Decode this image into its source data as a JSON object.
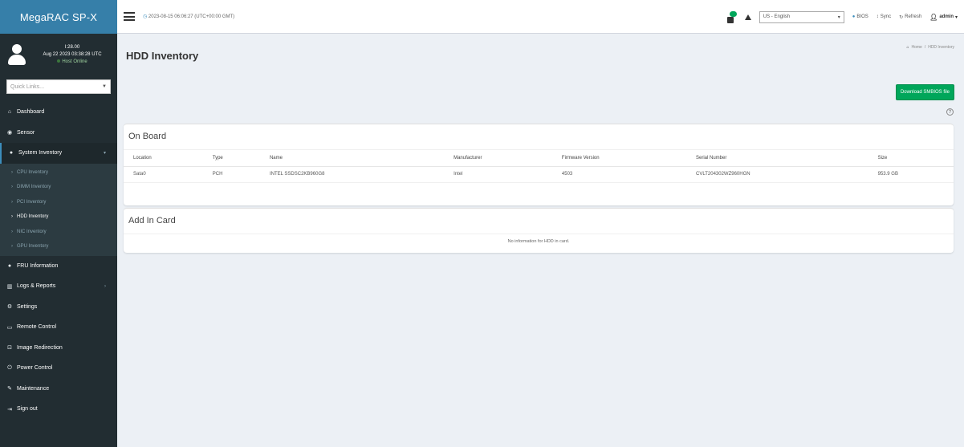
{
  "brand": "MegaRAC SP-X",
  "user_panel": {
    "line1": "I:28.00",
    "line2": "Aug 22 2023 03:38:28 UTC",
    "status": "Host Online"
  },
  "quick_links": {
    "placeholder": "Quick Links..."
  },
  "sidebar": {
    "items_top": [
      {
        "label": "Dashboard",
        "icon": "dashboard-icon",
        "glyph": "⌂"
      },
      {
        "label": "Sensor",
        "icon": "sensor-icon",
        "glyph": "◉"
      }
    ],
    "system_inventory": {
      "label": "System Inventory",
      "icon": "inventory-icon",
      "glyph": "●",
      "arrow": "▾"
    },
    "subitems": [
      {
        "label": "CPU Inventory",
        "active": false
      },
      {
        "label": "DIMM Inventory",
        "active": false
      },
      {
        "label": "PCI Inventory",
        "active": false
      },
      {
        "label": "HDD Inventory",
        "active": true
      },
      {
        "label": "NIC Inventory",
        "active": false
      },
      {
        "label": "GPU Inventory",
        "active": false
      }
    ],
    "items_bottom": [
      {
        "label": "FRU Information",
        "icon": "fru-icon",
        "glyph": "●",
        "arrow": ""
      },
      {
        "label": "Logs & Reports",
        "icon": "logs-icon",
        "glyph": "▥",
        "arrow": "›"
      },
      {
        "label": "Settings",
        "icon": "settings-icon",
        "glyph": "⚙",
        "arrow": ""
      },
      {
        "label": "Remote Control",
        "icon": "monitor-icon",
        "glyph": "▭",
        "arrow": ""
      },
      {
        "label": "Image Redirection",
        "icon": "image-redirection-icon",
        "glyph": "⊡",
        "arrow": ""
      },
      {
        "label": "Power Control",
        "icon": "power-icon",
        "glyph": "⏻",
        "arrow": ""
      },
      {
        "label": "Maintenance",
        "icon": "wrench-icon",
        "glyph": "✎",
        "arrow": ""
      },
      {
        "label": "Sign out",
        "icon": "sign-out-icon",
        "glyph": "⇥",
        "arrow": ""
      }
    ]
  },
  "topbar": {
    "datetime": "2023-08-15 06:06:27 (UTC+00:00 GMT)",
    "language": "US - English",
    "bios_label": "BIOS",
    "sync_label": "Sync",
    "refresh_label": "Refresh",
    "user_label": "admin"
  },
  "page": {
    "title": "HDD Inventory",
    "breadcrumb_home": "Home",
    "breadcrumb_sep": "/",
    "breadcrumb_current": "HDD Inventory",
    "download_label": "Download SMBIOS file"
  },
  "onboard": {
    "title": "On Board",
    "columns": [
      "Location",
      "Type",
      "Name",
      "Manufacturer",
      "Firmware Version",
      "Serial Number",
      "Size"
    ],
    "rows": [
      [
        "Sata0",
        "PCH",
        "INTEL SSDSC2KB960G8",
        "Intel",
        "4503",
        "CVLT204302WZ960HGN",
        "953.9 GB"
      ]
    ]
  },
  "addin": {
    "title": "Add In Card",
    "message": "No information for HDD in card."
  },
  "colors": {
    "sidebar_bg": "#222d32",
    "brand_bg": "#367fa9",
    "accent": "#3c8dbc",
    "download_btn": "#00a65a"
  }
}
